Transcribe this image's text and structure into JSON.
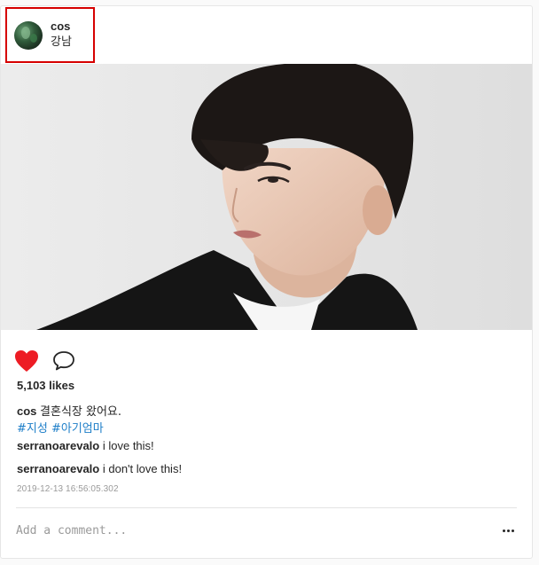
{
  "post": {
    "username": "cos",
    "location": "강남",
    "likes": "5,103 likes",
    "caption": {
      "user": "cos",
      "text": "결혼식장 왔어요.",
      "hashtags": [
        "#지성",
        "#아기엄마"
      ]
    },
    "comments": [
      {
        "user": "serranoarevalo",
        "text": "i love this!"
      },
      {
        "user": "serranoarevalo",
        "text": "i don't love this!"
      }
    ],
    "timestamp": "2019-12-13 16:56:05.302",
    "liked": true
  },
  "comment_box": {
    "placeholder": "Add a comment...",
    "value": ""
  },
  "icons": {
    "like": "heart-filled-icon",
    "comment": "speech-bubble-icon",
    "more": "more-horizontal-icon"
  },
  "colors": {
    "heart": "#ed1c24",
    "hashtag": "#1d7ec8",
    "highlight": "#d60000"
  }
}
